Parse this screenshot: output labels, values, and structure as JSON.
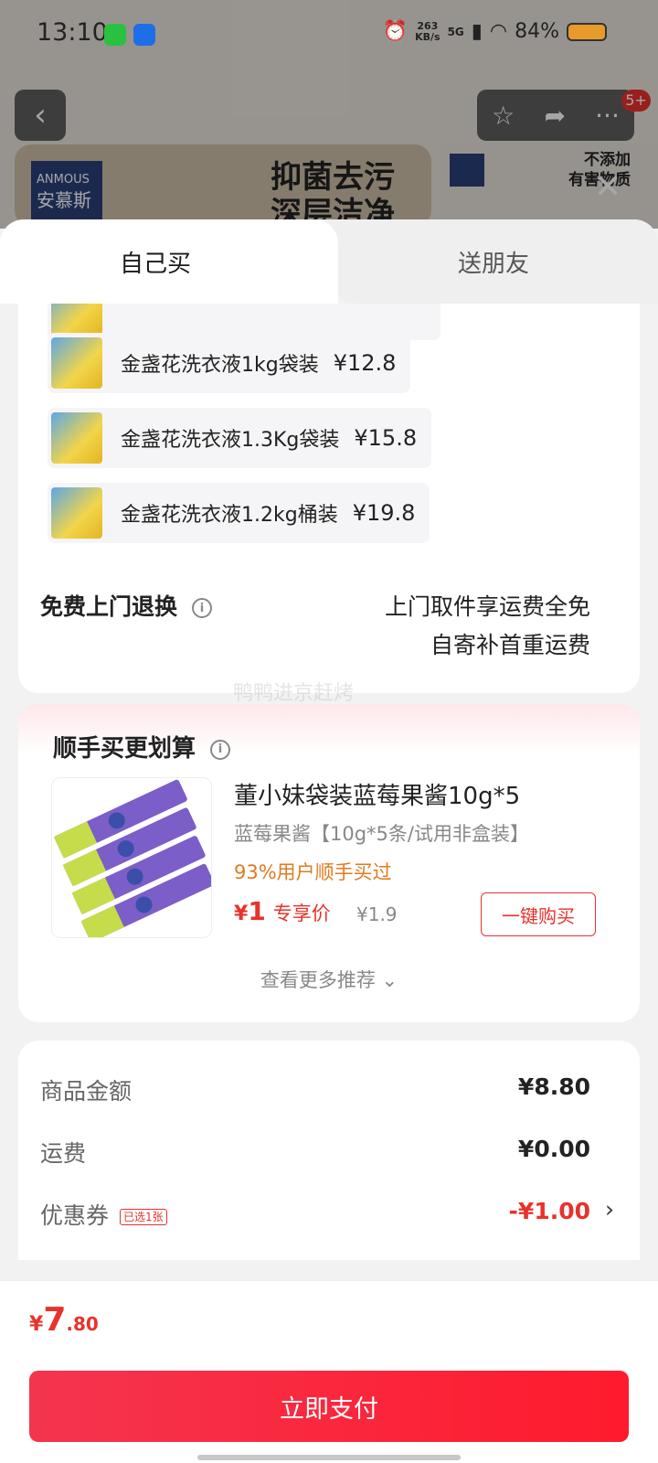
{
  "status_bar": {
    "time": "13:10",
    "net_speed_value": "263",
    "net_speed_unit": "KB/s",
    "network": "5G",
    "battery": "84%"
  },
  "background": {
    "badge_count": "5+",
    "banner_logo_en": "ANMOUS",
    "banner_logo_cn": "安慕斯",
    "banner_slogan_1": "抑菌去污",
    "banner_slogan_2": "深层洁净",
    "banner2_text_1": "不添加",
    "banner2_text_2": "有害物质"
  },
  "tabs": {
    "self": "自己买",
    "friend": "送朋友"
  },
  "gifts": [
    {
      "name": "金盏花洗衣液1kg袋装",
      "price": "¥12.8"
    },
    {
      "name": "金盏花洗衣液1.3Kg袋装",
      "price": "¥15.8"
    },
    {
      "name": "金盏花洗衣液1.2kg桶装",
      "price": "¥19.8"
    }
  ],
  "returns": {
    "title": "免费上门退换",
    "line1": "上门取件享运费全免",
    "line2": "自寄补首重运费"
  },
  "watermark": "鸭鸭进京赶烤",
  "recommend": {
    "title": "顺手买更划算",
    "product_name": "董小妹袋装蓝莓果酱10g*5",
    "spec": "蓝莓果酱【10g*5条/试用非盒装】",
    "bought": "93%用户顺手买过",
    "currency": "¥",
    "price": "1",
    "price_tag": "专享价",
    "original_price": "¥1.9",
    "buy_button": "一键购买",
    "more": "查看更多推荐"
  },
  "summary": {
    "goods_label": "商品金额",
    "goods_value": "¥8.80",
    "shipping_label": "运费",
    "shipping_value": "¥0.00",
    "coupon_label": "优惠券",
    "coupon_badge": "已选1张",
    "coupon_value": "-¥1.00"
  },
  "footer": {
    "currency": "¥",
    "total_int": "7",
    "total_dec": ".80",
    "pay_button": "立即支付"
  }
}
